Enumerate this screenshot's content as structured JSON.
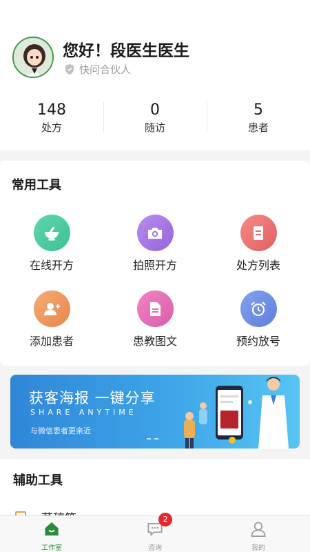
{
  "profile": {
    "greeting": "您好！段医生医生",
    "role": "快问合伙人"
  },
  "stats": [
    {
      "value": "148",
      "label": "处方"
    },
    {
      "value": "0",
      "label": "随访"
    },
    {
      "value": "5",
      "label": "患者"
    }
  ],
  "common_tools": {
    "title": "常用工具",
    "items": [
      {
        "label": "在线开方",
        "icon": "mortar-icon",
        "color": "#4cc9a0"
      },
      {
        "label": "拍照开方",
        "icon": "camera-icon",
        "color": "#a57be3"
      },
      {
        "label": "处方列表",
        "icon": "document-icon",
        "color": "#ec7474"
      },
      {
        "label": "添加患者",
        "icon": "add-user-icon",
        "color": "#ef9a62"
      },
      {
        "label": "患教图文",
        "icon": "file-icon",
        "color": "#e872b8"
      },
      {
        "label": "预约放号",
        "icon": "alarm-clock-icon",
        "color": "#6f8ee6"
      }
    ]
  },
  "banner": {
    "title": "获客海报 一键分享",
    "subtitle": "SHARE ANYTIME",
    "description": "与微信患者更亲近"
  },
  "aux_tools": {
    "title": "辅助工具",
    "first_item": "草稿箱"
  },
  "tabbar": {
    "items": [
      {
        "label": "工作室",
        "icon": "home-icon"
      },
      {
        "label": "咨询",
        "icon": "chat-icon",
        "badge": "2"
      },
      {
        "label": "我的",
        "icon": "profile-icon"
      }
    ]
  },
  "colors": {
    "accent": "#2d8a3b",
    "badge": "#e8272a"
  }
}
